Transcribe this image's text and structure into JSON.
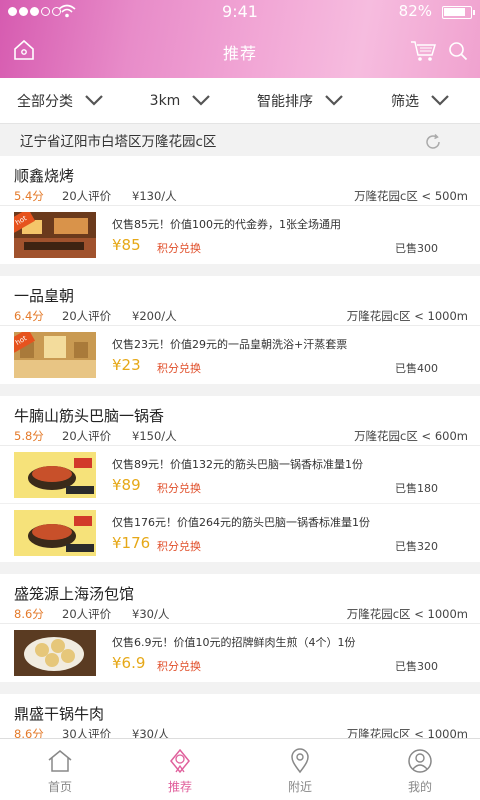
{
  "status": {
    "time": "9:41",
    "battery": "82%",
    "battery_level": 0.82
  },
  "header": {
    "title": "推荐",
    "home_icon": "home-icon",
    "cart_icon": "cart-icon",
    "search_icon": "search-icon"
  },
  "filters": [
    {
      "label": "全部分类"
    },
    {
      "label": "3km"
    },
    {
      "label": "智能排序"
    },
    {
      "label": "筛选"
    }
  ],
  "location": {
    "address": "辽宁省辽阳市白塔区万隆花园c区",
    "refresh_icon": "refresh-icon"
  },
  "shops": [
    {
      "name": "顺鑫烧烤",
      "score": "5.4分",
      "reviews": "20人评价",
      "price": "¥130/人",
      "area": "万隆花园c区",
      "distance": "500m",
      "deals": [
        {
          "desc": "仅售85元！价值100元的代金券，1张全场通用",
          "price": "¥85",
          "points": "积分兑换",
          "sold": "已售300",
          "hot": "hot"
        }
      ]
    },
    {
      "name": "一品皇朝",
      "score": "6.4分",
      "reviews": "20人评价",
      "price": "¥200/人",
      "area": "万隆花园c区",
      "distance": "1000m",
      "deals": [
        {
          "desc": "仅售23元！价值29元的一品皇朝洗浴+汗蒸套票",
          "price": "¥23",
          "points": "积分兑换",
          "sold": "已售400",
          "hot": "hot"
        }
      ]
    },
    {
      "name": "牛腩山筋头巴脑一锅香",
      "score": "5.8分",
      "reviews": "20人评价",
      "price": "¥150/人",
      "area": "万隆花园c区",
      "distance": "600m",
      "deals": [
        {
          "desc": "仅售89元！价值132元的筋头巴脑一锅香标准量1份",
          "price": "¥89",
          "points": "积分兑换",
          "sold": "已售180"
        },
        {
          "desc": "仅售176元！价值264元的筋头巴脑一锅香标准量1份",
          "price": "¥176",
          "points": "积分兑换",
          "sold": "已售320"
        }
      ]
    },
    {
      "name": "盛笼源上海汤包馆",
      "score": "8.6分",
      "reviews": "20人评价",
      "price": "¥30/人",
      "area": "万隆花园c区",
      "distance": "1000m",
      "deals": [
        {
          "desc": "仅售6.9元！价值10元的招牌鲜肉生煎（4个）1份",
          "price": "¥6.9",
          "points": "积分兑换",
          "sold": "已售300"
        }
      ]
    },
    {
      "name": "鼎盛干锅牛肉",
      "score": "8.6分",
      "reviews": "30人评价",
      "price": "¥30/人",
      "area": "万隆花园c区",
      "distance": "1000m",
      "deals": []
    }
  ],
  "tabbar": [
    {
      "label": "首页",
      "icon": "home-tab-icon"
    },
    {
      "label": "推荐",
      "icon": "recommend-tab-icon",
      "active": true
    },
    {
      "label": "附近",
      "icon": "location-pin-icon"
    },
    {
      "label": "我的",
      "icon": "user-icon"
    }
  ],
  "colors": {
    "accent": "#e0609c",
    "score": "#e47a2a",
    "price": "#e6a818",
    "points": "#e0502c"
  }
}
